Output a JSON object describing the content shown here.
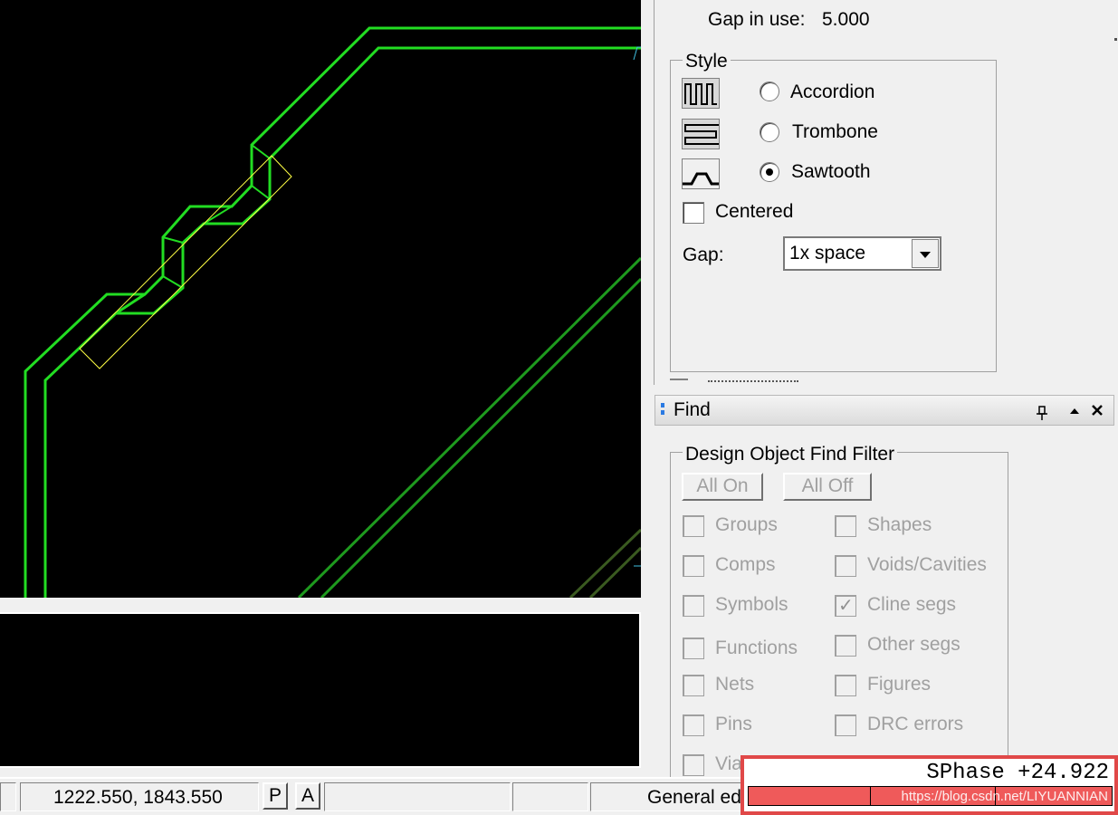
{
  "colors": {
    "canvas_bg": "#000000",
    "trace_bright": "#22dd22",
    "trace_dark": "#1e7a1e",
    "highlight_box": "#ffff44",
    "cyan_marker": "#40c0e0",
    "highlight_red": "#e04848"
  },
  "options_panel": {
    "gap_in_use_label": "Gap in use:",
    "gap_in_use_value": "5.000",
    "style_group_label": "Style",
    "style_options": [
      {
        "label": "Accordion",
        "icon": "accordion-icon",
        "selected": false
      },
      {
        "label": "Trombone",
        "icon": "trombone-icon",
        "selected": false
      },
      {
        "label": "Sawtooth",
        "icon": "sawtooth-icon",
        "selected": true
      }
    ],
    "centered_label": "Centered",
    "centered_checked": false,
    "gap_label": "Gap:",
    "gap_value": "1x space"
  },
  "find_panel": {
    "title": "Find",
    "pin_icon": "pin-icon",
    "collapse_icon": "collapse-up-icon",
    "close_icon": "close-icon",
    "filter_group_label": "Design Object Find Filter",
    "all_on_label": "All On",
    "all_off_label": "All Off",
    "left_items": [
      {
        "label": "Groups",
        "checked": false
      },
      {
        "label": "Comps",
        "checked": false
      },
      {
        "label": "Symbols",
        "checked": false
      },
      {
        "label": "Functions",
        "checked": false
      },
      {
        "label": "Nets",
        "checked": false
      },
      {
        "label": "Pins",
        "checked": false
      },
      {
        "label": "Via",
        "checked": false
      }
    ],
    "right_items": [
      {
        "label": "Shapes",
        "checked": false
      },
      {
        "label": "Voids/Cavities",
        "checked": false
      },
      {
        "label": "Cline segs",
        "checked": true
      },
      {
        "label": "Other segs",
        "checked": false
      },
      {
        "label": "Figures",
        "checked": false
      },
      {
        "label": "DRC errors",
        "checked": false
      }
    ]
  },
  "statusbar": {
    "coordinates": "1222.550, 1843.550",
    "p_button": "P",
    "a_button": "A",
    "mode": "General ed"
  },
  "sphase": {
    "text": "SPhase +24.922",
    "watermark": "https://blog.csdn.net/LIYUANNIAN"
  }
}
